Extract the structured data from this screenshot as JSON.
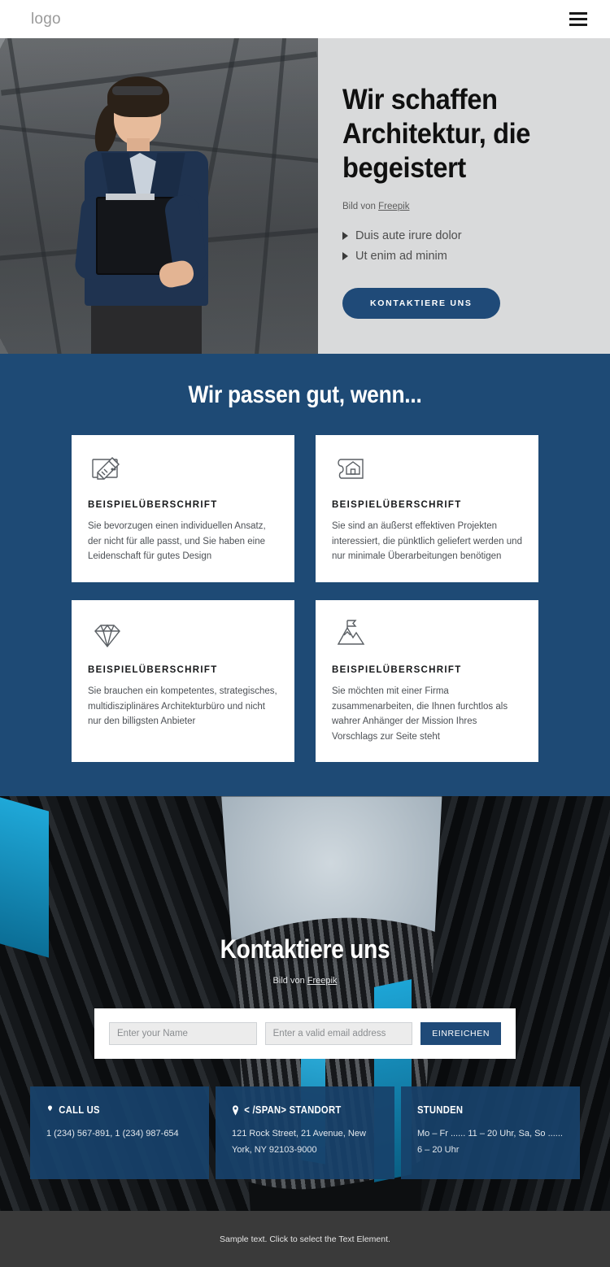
{
  "header": {
    "logo": "logo",
    "menu_icon": "hamburger-menu-icon"
  },
  "hero": {
    "title": "Wir schaffen Architektur, die begeistert",
    "credit_prefix": "Bild von ",
    "credit_link": "Freepik",
    "bullets": [
      "Duis aute irure dolor",
      "Ut enim ad minim"
    ],
    "cta_label": "KONTAKTIERE UNS"
  },
  "features": {
    "heading": "Wir passen gut, wenn...",
    "cards": [
      {
        "icon": "ruler-pencil-icon",
        "title": "BEISPIELÜBERSCHRIFT",
        "body": "Sie bevorzugen einen individuellen Ansatz, der nicht für alle passt, und Sie haben eine Leidenschaft für gutes Design"
      },
      {
        "icon": "blueprint-house-icon",
        "title": "BEISPIELÜBERSCHRIFT",
        "body": "Sie sind an äußerst effektiven Projekten interessiert, die pünktlich geliefert werden und nur minimale Überarbeitungen benötigen"
      },
      {
        "icon": "diamond-icon",
        "title": "BEISPIELÜBERSCHRIFT",
        "body": "Sie brauchen ein kompetentes, strategisches, multidisziplinäres Architekturbüro und nicht nur den billigsten Anbieter"
      },
      {
        "icon": "mountain-flag-icon",
        "title": "BEISPIELÜBERSCHRIFT",
        "body": "Sie möchten mit einer Firma zusammenarbeiten, die Ihnen furchtlos als wahrer Anhänger der Mission Ihres Vorschlags zur Seite steht"
      }
    ]
  },
  "contact": {
    "heading": "Kontaktiere uns",
    "credit_prefix": "Bild von ",
    "credit_link": "Freepik",
    "form": {
      "name_placeholder": "Enter your Name",
      "name_value": "",
      "email_placeholder": "Enter a valid email address",
      "email_value": "",
      "submit_label": "EINREICHEN"
    },
    "info_boxes": [
      {
        "icon": "phone-icon",
        "title": "CALL US",
        "body": "1 (234) 567-891, 1 (234) 987-654"
      },
      {
        "icon": "location-pin-icon",
        "title": "< /SPAN> STANDORT",
        "body": "121 Rock Street, 21 Avenue, New York, NY 92103-9000"
      },
      {
        "icon": "",
        "title": "STUNDEN",
        "body": "Mo – Fr ...... 11 – 20 Uhr, Sa, So  ...... 6 – 20 Uhr"
      }
    ]
  },
  "footer": {
    "text": "Sample text. Click to select the Text Element."
  },
  "colors": {
    "brand_blue": "#1e4a75",
    "button_blue": "#1f4a78",
    "hero_panel_gray": "#d9dadb",
    "footer_gray": "#3a3a3a"
  }
}
